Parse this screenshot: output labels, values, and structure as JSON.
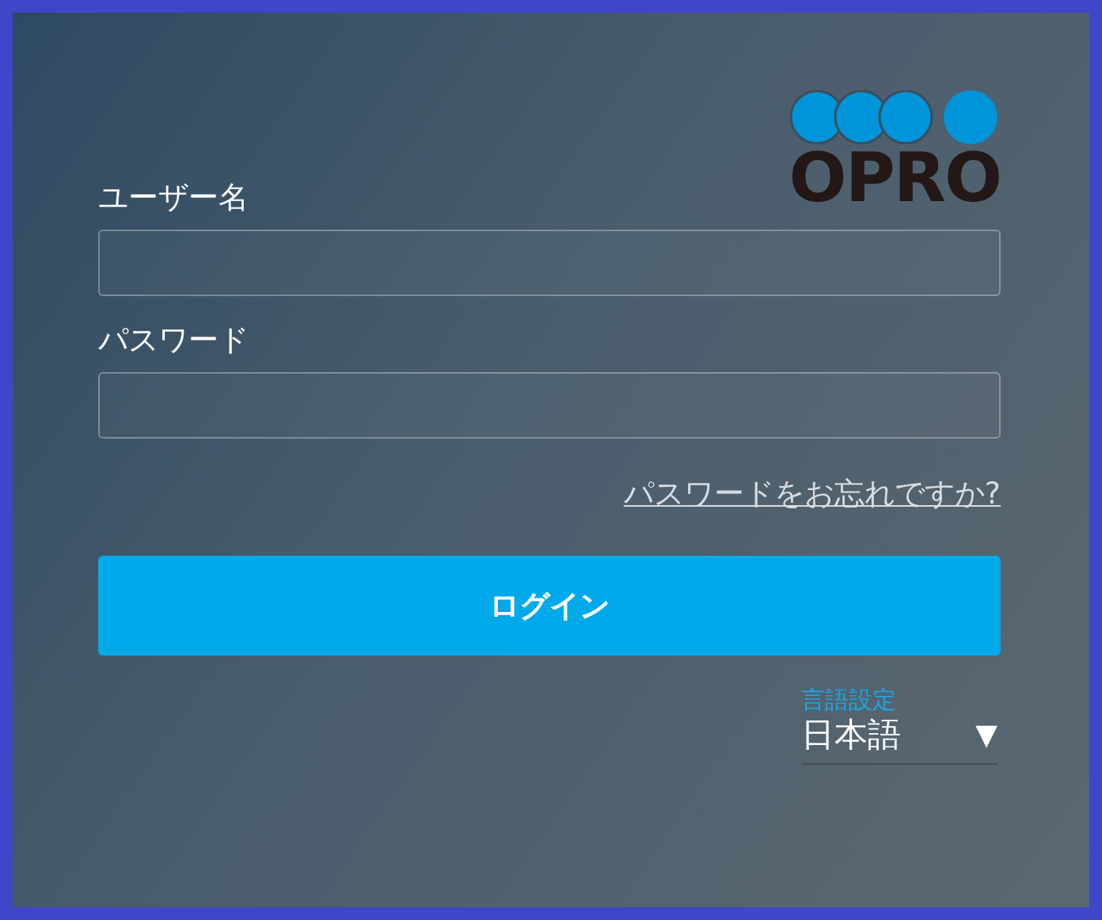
{
  "logo": {
    "text": "OPRO"
  },
  "fields": [
    {
      "label": "ユーザー名"
    },
    {
      "label": "パスワード"
    }
  ],
  "forgot_link": "パスワードをお忘れですか?",
  "login_button": "ログイン",
  "language": {
    "label": "言語設定",
    "value": "日本語",
    "arrow": "▼"
  }
}
